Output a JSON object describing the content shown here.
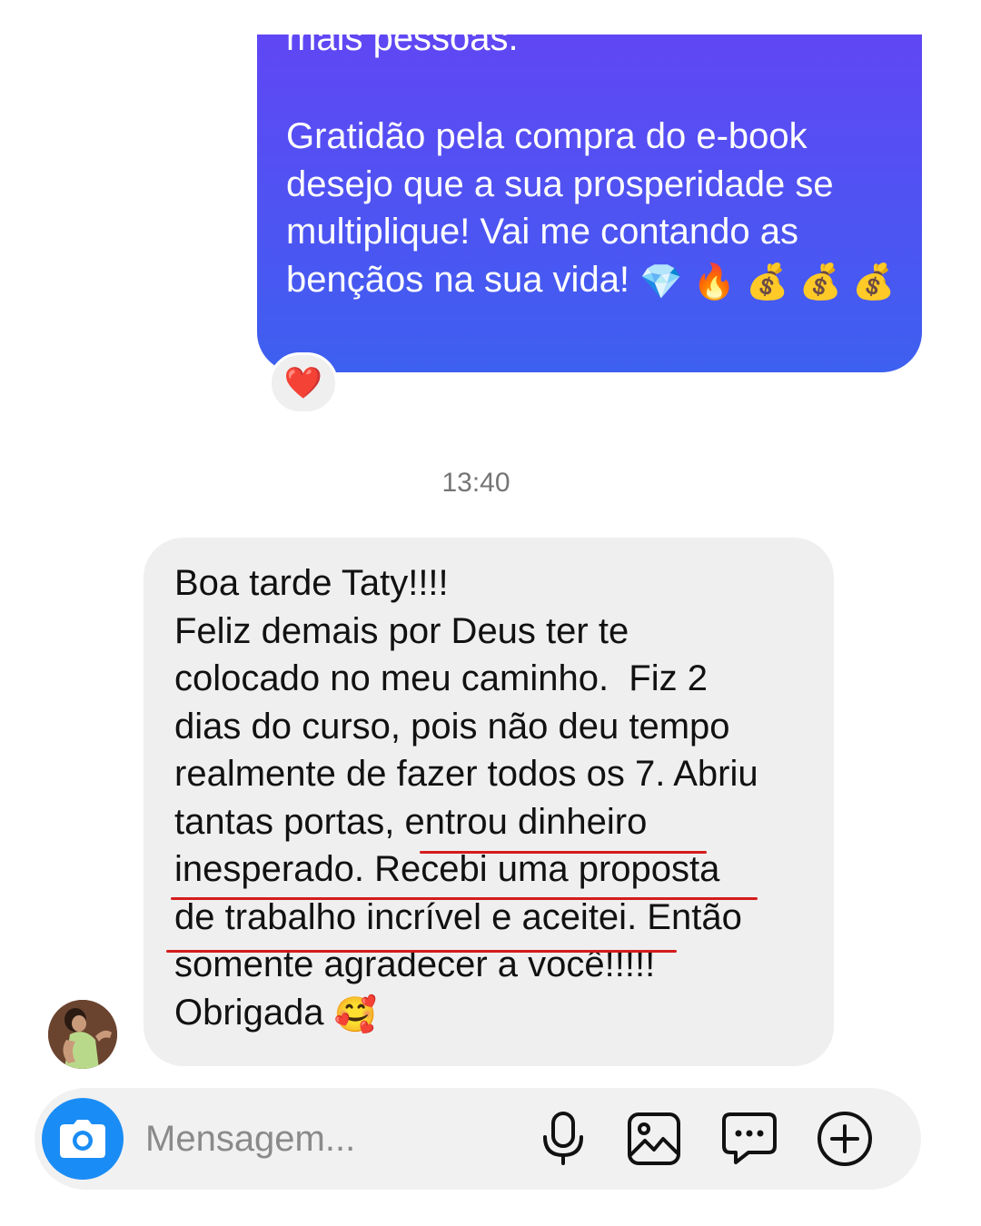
{
  "conversation": {
    "sent_message": {
      "cut_line": "mais pessoas.",
      "text": "Gratidão pela compra do e-book desejo que a sua prosperidade se multiplique! Vai me contando as bençãos na sua vida!",
      "emojis": [
        "💎",
        "🔥",
        "💰",
        "💰",
        "💰"
      ],
      "reaction": "❤️"
    },
    "timestamp": "13:40",
    "received_message": {
      "lines": [
        "Boa tarde Taty!!!!",
        "Feliz demais por Deus ter te",
        "colocado no meu caminho.  Fiz 2",
        "dias do curso, pois não deu tempo",
        "realmente de fazer todos os 7. Abriu",
        "tantas portas, entrou dinheiro",
        "inesperado. Recebi uma proposta",
        "de trabalho incrível e aceitei. Então",
        "somente agradecer a você!!!!!",
        "Obrigada"
      ],
      "emoji": "🥰"
    }
  },
  "composer": {
    "placeholder": "Mensagem...",
    "icons": [
      "camera-icon",
      "microphone-icon",
      "image-icon",
      "sticker-icon",
      "plus-icon"
    ]
  },
  "colors": {
    "sent_gradient_top": "#6047f4",
    "sent_gradient_bottom": "#3d60f0",
    "received_bg": "#efefef",
    "underline": "#d41c1c",
    "camera_button": "#1a8cf5"
  }
}
